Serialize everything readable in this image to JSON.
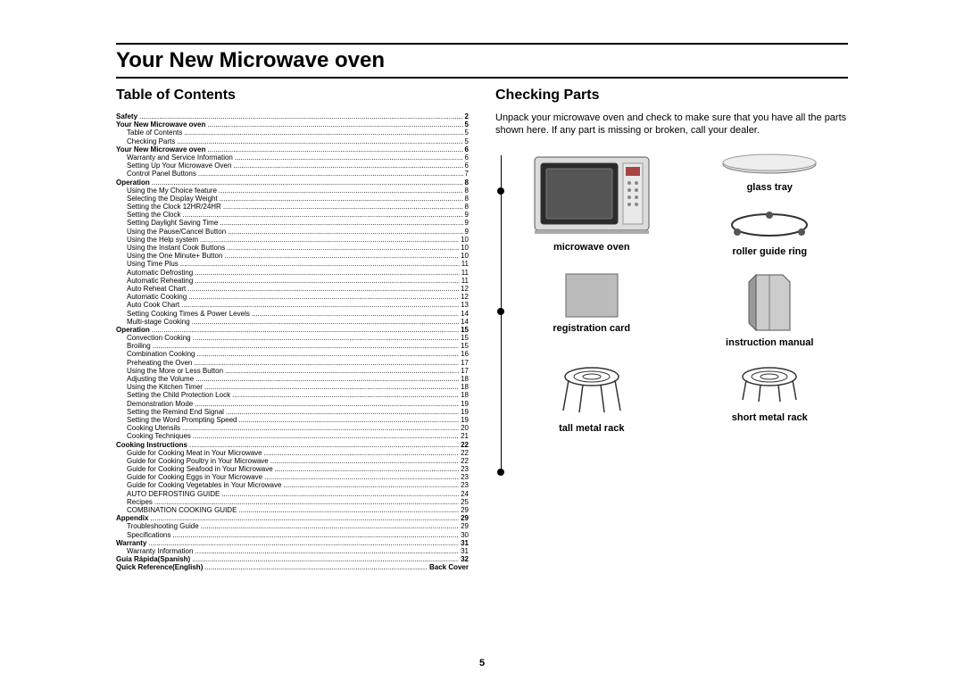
{
  "page_number": "5",
  "main_heading": "Your New Microwave oven",
  "left": {
    "heading": "Table of Contents",
    "toc": [
      {
        "level": 1,
        "title": "Safety",
        "page": "2"
      },
      {
        "level": 1,
        "title": "Your New Microwave oven",
        "page": "5"
      },
      {
        "level": 2,
        "title": "Table of Contents",
        "page": "5"
      },
      {
        "level": 2,
        "title": "Checking Parts",
        "page": "5"
      },
      {
        "level": 1,
        "title": "Your New Microwave oven",
        "page": "6"
      },
      {
        "level": 2,
        "title": "Warranty and Service Information",
        "page": "6"
      },
      {
        "level": 2,
        "title": "Setting Up Your Microwave Oven",
        "page": "6"
      },
      {
        "level": 2,
        "title": "Control Panel Buttons",
        "page": "7"
      },
      {
        "level": 1,
        "title": "Operation",
        "page": "8"
      },
      {
        "level": 2,
        "title": "Using the My Choice feature",
        "page": "8"
      },
      {
        "level": 2,
        "title": "Selecting the Display Weight",
        "page": "8"
      },
      {
        "level": 2,
        "title": "Setting the Clock 12HR/24HR",
        "page": "8"
      },
      {
        "level": 2,
        "title": "Setting the Clock",
        "page": "9"
      },
      {
        "level": 2,
        "title": "Setting Daylight Saving Time",
        "page": "9"
      },
      {
        "level": 2,
        "title": "Using the Pause/Cancel Button",
        "page": "9"
      },
      {
        "level": 2,
        "title": "Using the Help system",
        "page": "10"
      },
      {
        "level": 2,
        "title": "Using the Instant Cook Buttons",
        "page": "10"
      },
      {
        "level": 2,
        "title": "Using the One Minute+ Button",
        "page": "10"
      },
      {
        "level": 2,
        "title": "Using Time Plus",
        "page": "11"
      },
      {
        "level": 2,
        "title": "Automatic Defrosting",
        "page": "11"
      },
      {
        "level": 2,
        "title": "Automatic Reheating",
        "page": "11"
      },
      {
        "level": 2,
        "title": "Auto Reheat Chart",
        "page": "12"
      },
      {
        "level": 2,
        "title": "Automatic Cooking",
        "page": "12"
      },
      {
        "level": 2,
        "title": "Auto Cook Chart",
        "page": "13"
      },
      {
        "level": 2,
        "title": "Setting Cooking Times & Power Levels",
        "page": "14"
      },
      {
        "level": 2,
        "title": "Multi-stage Cooking",
        "page": "14"
      },
      {
        "level": 1,
        "title": "Operation",
        "page": "15"
      },
      {
        "level": 2,
        "title": "Convection Cooking",
        "page": "15"
      },
      {
        "level": 2,
        "title": "Broiling",
        "page": "15"
      },
      {
        "level": 2,
        "title": "Combination Cooking",
        "page": "16"
      },
      {
        "level": 2,
        "title": "Preheating the Oven",
        "page": "17"
      },
      {
        "level": 2,
        "title": "Using the More or Less Button",
        "page": "17"
      },
      {
        "level": 2,
        "title": "Adjusting the Volume",
        "page": "18"
      },
      {
        "level": 2,
        "title": "Using the Kitchen Timer",
        "page": "18"
      },
      {
        "level": 2,
        "title": "Setting the Child Protection Lock",
        "page": "18"
      },
      {
        "level": 2,
        "title": "Demonstration Mode",
        "page": "19"
      },
      {
        "level": 2,
        "title": "Setting the Remind End Signal",
        "page": "19"
      },
      {
        "level": 2,
        "title": "Setting the Word Prompting Speed",
        "page": "19"
      },
      {
        "level": 2,
        "title": "Cooking Utensils",
        "page": "20"
      },
      {
        "level": 2,
        "title": "Cooking Techniques",
        "page": "21"
      },
      {
        "level": 1,
        "title": "Cooking Instructions",
        "page": "22"
      },
      {
        "level": 2,
        "title": "Guide for Cooking Meat in Your Microwave",
        "page": "22"
      },
      {
        "level": 2,
        "title": "Guide for Cooking Poultry in Your Microwave",
        "page": "22"
      },
      {
        "level": 2,
        "title": "Guide for Cooking Seafood in Your Microwave",
        "page": "23"
      },
      {
        "level": 2,
        "title": "Guide for Cooking Eggs in Your Microwave",
        "page": "23"
      },
      {
        "level": 2,
        "title": "Guide for Cooking Vegetables in Your Microwave",
        "page": "23"
      },
      {
        "level": 2,
        "title": "AUTO DEFROSTING GUIDE",
        "page": "24"
      },
      {
        "level": 2,
        "title": "Recipes",
        "page": "25"
      },
      {
        "level": 2,
        "title": "COMBINATION COOKING GUIDE",
        "page": "29"
      },
      {
        "level": 1,
        "title": "Appendix",
        "page": "29"
      },
      {
        "level": 2,
        "title": "Troubleshooting Guide",
        "page": "29"
      },
      {
        "level": 2,
        "title": "Specifications",
        "page": "30"
      },
      {
        "level": 1,
        "title": "Warranty",
        "page": "31"
      },
      {
        "level": 2,
        "title": "Warranty Information",
        "page": "31"
      },
      {
        "level": 1,
        "title": "Guía Rápida(Spanish)",
        "page": "32"
      },
      {
        "level": 1,
        "title": "Quick Reference(English)",
        "page": "Back Cover"
      }
    ]
  },
  "right": {
    "heading": "Checking Parts",
    "intro": "Unpack your microwave oven and check to make sure that you have all the parts shown here. If any part is missing or broken, call your dealer.",
    "parts": [
      {
        "label": "microwave oven",
        "icon": "microwave"
      },
      {
        "label": "glass tray",
        "icon": "glass-tray"
      },
      {
        "label": "registration card",
        "icon": "card"
      },
      {
        "label": "roller guide ring",
        "icon": "roller-ring"
      },
      {
        "label": "tall metal rack",
        "icon": "tall-rack"
      },
      {
        "label": "instruction manual",
        "icon": "manual"
      },
      {
        "label": "short metal rack",
        "icon": "short-rack"
      }
    ]
  }
}
